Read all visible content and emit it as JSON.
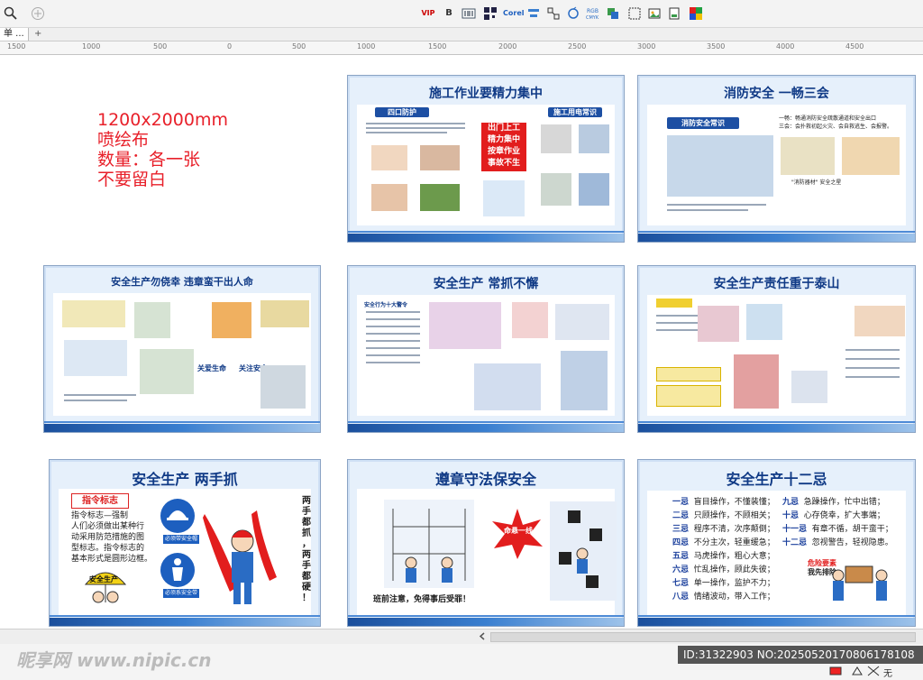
{
  "toolbar": {
    "items": [
      {
        "label": "VIP",
        "icon": "vip-icon"
      },
      {
        "label": "B",
        "icon": "bold-icon"
      },
      {
        "label": "Corel",
        "icon": "corel-icon"
      }
    ]
  },
  "tab": {
    "label": "单 ...",
    "add": "+"
  },
  "ruler": {
    "ticks": [
      "1500",
      "1000",
      "500",
      "0",
      "500",
      "1000",
      "1500",
      "2000",
      "2500",
      "3000",
      "3500",
      "4000",
      "4500"
    ]
  },
  "spec": {
    "size": "1200x2000mm",
    "material": "喷绘布",
    "quantity": "数量：各一张",
    "note": "不要留白"
  },
  "boards": {
    "b1": {
      "title": "施工作业要精力集中",
      "sub1": "四口防护",
      "sub2": "施工用电常识",
      "red": [
        "出门上工",
        "精力集中",
        "按章作业",
        "事故不生"
      ]
    },
    "b2": {
      "title": "消防安全  一畅三会",
      "sub": "消防安全常识",
      "text1": "一畅：畅通消防安全疏散通道和安全出口",
      "text2": "三会：会扑救初起火灾、会自救逃生、会报警。",
      "cap": "\"消防器材\" 安全之星"
    },
    "b3": {
      "title": "安全生产勿侥幸   违章蛮干出人命",
      "m1": "关爱生命",
      "m2": "关注安全"
    },
    "b4": {
      "title": "安全生产  常抓不懈",
      "sub": "安全行为十大警令"
    },
    "b5": {
      "title": "安全生产责任重于泰山"
    },
    "b6": {
      "title": "安全生产 两手抓",
      "sub": "指令标志",
      "desc": [
        "指令标志—强制",
        "人们必须做出某种行",
        "动采用防范措施的图",
        "型标志。指令标志的",
        "基本形式是圆形边框。"
      ],
      "sign1": "必须带安全帽",
      "sign2": "必须系安全带",
      "side": [
        "两",
        "手",
        "都",
        "抓",
        "，",
        "两",
        "手",
        "都",
        "硬",
        "！"
      ],
      "umbrella": "安全生产"
    },
    "b7": {
      "title": "遵章守法保安全",
      "burst": "命悬一线",
      "caption": "班前注意，免得事后受罪！"
    },
    "b8": {
      "title": "安全生产十二忌",
      "left": [
        {
          "k": "一忌",
          "v": "盲目操作，不懂装懂；"
        },
        {
          "k": "二忌",
          "v": "只顾操作，不顾相关；"
        },
        {
          "k": "三忌",
          "v": "程序不清，次序颠倒；"
        },
        {
          "k": "四忌",
          "v": "不分主次，轻重缓急；"
        },
        {
          "k": "五忌",
          "v": "马虎操作，粗心大意；"
        },
        {
          "k": "六忌",
          "v": "忙乱操作，顾此失彼；"
        },
        {
          "k": "七忌",
          "v": "单一操作，监护不力；"
        },
        {
          "k": "八忌",
          "v": "情绪波动，带入工作；"
        }
      ],
      "right": [
        {
          "k": "九忌",
          "v": "急躁操作，忙中出错；"
        },
        {
          "k": "十忌",
          "v": "心存侥幸，扩大事端；"
        },
        {
          "k": "十一忌",
          "v": "有章不循，胡干蛮干；"
        },
        {
          "k": "十二忌",
          "v": "忽视警告，轻视隐患。"
        }
      ],
      "warn1": "危险要素",
      "warn2": "我先排除"
    }
  },
  "bottom": {
    "watermark": "昵享网 www.nipic.cn",
    "id": "ID:31322903 NO:20250520170806178108",
    "status_right": "无"
  },
  "colors": {
    "title_blue": "#103a86",
    "spec_red": "#e8202a",
    "board_bg": "#e6f0fb"
  }
}
